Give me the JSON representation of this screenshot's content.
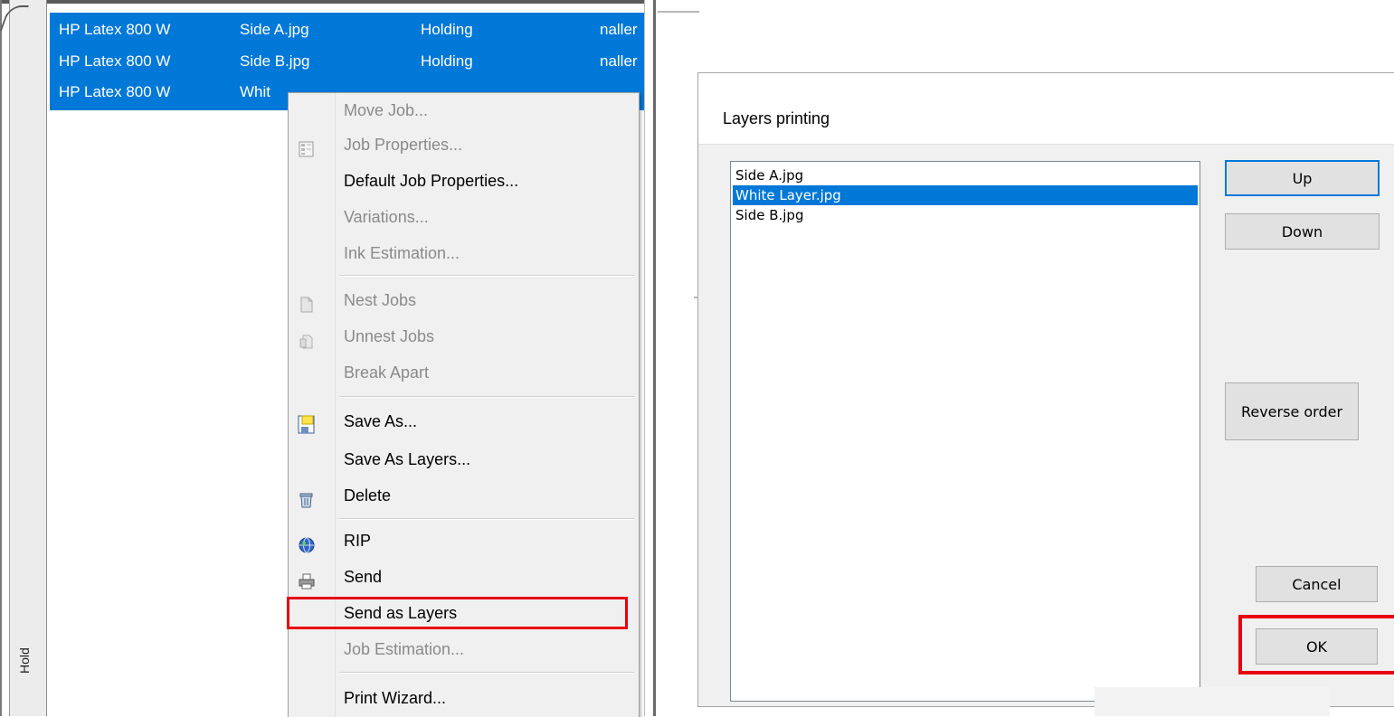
{
  "job_queue": {
    "side_tab_label": "Hold",
    "rows": [
      {
        "printer": "HP Latex 800 W",
        "file": "Side A.jpg",
        "status": "Holding",
        "owner": "naller"
      },
      {
        "printer": "HP Latex 800 W",
        "file": "Side B.jpg",
        "status": "Holding",
        "owner": "naller"
      },
      {
        "printer": "HP Latex 800 W",
        "file": "Whit",
        "status": "",
        "owner": ""
      }
    ]
  },
  "context_menu": {
    "items": [
      {
        "label": "Move Job...",
        "disabled": true,
        "icon": ""
      },
      {
        "label": "Job Properties...",
        "disabled": true,
        "icon": "properties-icon"
      },
      {
        "label": "Default Job Properties...",
        "disabled": false,
        "icon": ""
      },
      {
        "label": "Variations...",
        "disabled": true,
        "icon": ""
      },
      {
        "label": "Ink Estimation...",
        "disabled": true,
        "icon": ""
      },
      {
        "label": "Nest Jobs",
        "disabled": true,
        "icon": "nest-icon"
      },
      {
        "label": "Unnest Jobs",
        "disabled": true,
        "icon": "unnest-icon"
      },
      {
        "label": "Break Apart",
        "disabled": true,
        "icon": ""
      },
      {
        "label": "Save As...",
        "disabled": false,
        "icon": "save-as-icon"
      },
      {
        "label": "Save As Layers...",
        "disabled": false,
        "icon": ""
      },
      {
        "label": "Delete",
        "disabled": false,
        "icon": "trash-icon"
      },
      {
        "label": "RIP",
        "disabled": false,
        "icon": "globe-icon"
      },
      {
        "label": "Send",
        "disabled": false,
        "icon": "printer-icon"
      },
      {
        "label": "Send as Layers",
        "disabled": false,
        "icon": ""
      },
      {
        "label": "Job Estimation...",
        "disabled": true,
        "icon": ""
      },
      {
        "label": "Print Wizard...",
        "disabled": false,
        "icon": ""
      }
    ]
  },
  "layers_dialog": {
    "title": "Layers printing",
    "layers": [
      "Side A.jpg",
      "White Layer.jpg",
      "Side B.jpg"
    ],
    "selected_index": 1,
    "buttons": {
      "up": "Up",
      "down": "Down",
      "reverse": "Reverse order",
      "cancel": "Cancel",
      "ok": "OK"
    }
  },
  "colors": {
    "selection": "#0078d7",
    "highlight_box": "#e8000b",
    "menu_bg": "#f0f0f0"
  }
}
